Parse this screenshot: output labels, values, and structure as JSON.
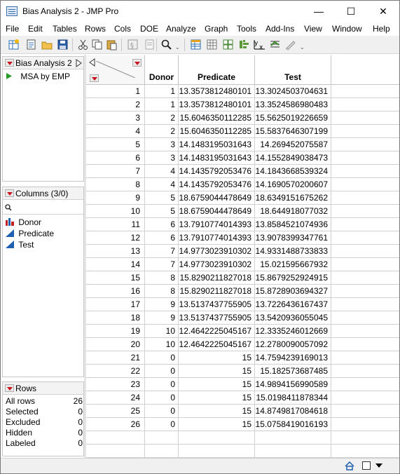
{
  "window": {
    "title": "Bias Analysis 2 - JMP Pro",
    "controls": {
      "minimize": "—",
      "maximize": "☐",
      "close": "✕"
    }
  },
  "menu": [
    "File",
    "Edit",
    "Tables",
    "Rows",
    "Cols",
    "DOE",
    "Analyze",
    "Graph",
    "Tools",
    "Add-Ins",
    "View",
    "Window",
    "Help"
  ],
  "toolbar_icons": [
    "new-table-icon",
    "new-script-icon",
    "open-icon",
    "save-icon",
    "cut-icon",
    "copy-icon",
    "paste-icon",
    "journal-icon",
    "search-icon",
    "table-icon",
    "data-grid-icon",
    "distribution-icon",
    "fit-y-by-x-icon",
    "fit-model-icon",
    "control-chart-icon"
  ],
  "table_panel": {
    "title": "Bias Analysis 2",
    "scripts": [
      "MSA by EMP"
    ]
  },
  "columns_panel": {
    "title": "Columns (3/0)",
    "search_placeholder": "",
    "columns": [
      {
        "name": "Donor",
        "type": "ordinal-icon"
      },
      {
        "name": "Predicate",
        "type": "continuous-icon"
      },
      {
        "name": "Test",
        "type": "continuous-icon"
      }
    ]
  },
  "rows_panel": {
    "title": "Rows",
    "stats": [
      {
        "label": "All rows",
        "value": "26"
      },
      {
        "label": "Selected",
        "value": "0"
      },
      {
        "label": "Excluded",
        "value": "0"
      },
      {
        "label": "Hidden",
        "value": "0"
      },
      {
        "label": "Labeled",
        "value": "0"
      }
    ]
  },
  "table": {
    "headers": [
      "Donor",
      "Predicate",
      "Test"
    ],
    "rows": [
      [
        "1",
        "1",
        "13.3573812480101",
        "13.3024503704631"
      ],
      [
        "2",
        "1",
        "13.3573812480101",
        "13.3524586980483"
      ],
      [
        "3",
        "2",
        "15.6046350112285",
        "15.5625019226659"
      ],
      [
        "4",
        "2",
        "15.6046350112285",
        "15.5837646307199"
      ],
      [
        "5",
        "3",
        "14.1483195031643",
        "14.269452075587"
      ],
      [
        "6",
        "3",
        "14.1483195031643",
        "14.1552849038473"
      ],
      [
        "7",
        "4",
        "14.1435792053476",
        "14.1843668539324"
      ],
      [
        "8",
        "4",
        "14.1435792053476",
        "14.1690570200607"
      ],
      [
        "9",
        "5",
        "18.6759044478649",
        "18.6349151675262"
      ],
      [
        "10",
        "5",
        "18.6759044478649",
        "18.644918077032"
      ],
      [
        "11",
        "6",
        "13.7910774014393",
        "13.8584521074936"
      ],
      [
        "12",
        "6",
        "13.7910774014393",
        "13.9078399347761"
      ],
      [
        "13",
        "7",
        "14.9773023910302",
        "14.9331488733833"
      ],
      [
        "14",
        "7",
        "14.9773023910302",
        "15.021595667932"
      ],
      [
        "15",
        "8",
        "15.8290211827018",
        "15.8679252924915"
      ],
      [
        "16",
        "8",
        "15.8290211827018",
        "15.8728903694327"
      ],
      [
        "17",
        "9",
        "13.5137437755905",
        "13.7226436167437"
      ],
      [
        "18",
        "9",
        "13.5137437755905",
        "13.5420936055045"
      ],
      [
        "19",
        "10",
        "12.4642225045167",
        "12.3335246012669"
      ],
      [
        "20",
        "10",
        "12.4642225045167",
        "12.2780090057092"
      ],
      [
        "21",
        "0",
        "15",
        "14.7594239169013"
      ],
      [
        "22",
        "0",
        "15",
        "15.182573687485"
      ],
      [
        "23",
        "0",
        "15",
        "14.9894156990589"
      ],
      [
        "24",
        "0",
        "15",
        "15.0198411878344"
      ],
      [
        "25",
        "0",
        "15",
        "14.8749817084618"
      ],
      [
        "26",
        "0",
        "15",
        "15.0758419016193"
      ]
    ]
  }
}
